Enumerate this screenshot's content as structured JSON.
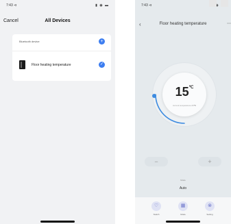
{
  "phone1": {
    "status": {
      "time": "7:43 ⊲",
      "icons": "▮ ◉ ▬"
    },
    "nav": {
      "cancel": "Cancel",
      "title": "All Devices"
    },
    "section_label": "Bluetooth device",
    "add_symbol": "+",
    "device": {
      "name": "Floor heating temperature",
      "check_symbol": "✓"
    }
  },
  "phone2": {
    "status": {
      "time": "7:43 ⊲",
      "icons": "▮ ◉ ▬"
    },
    "nav": {
      "back": "‹",
      "title": "Floor heating temperature",
      "more": "⋯"
    },
    "thermostat": {
      "temperature": "15",
      "unit": "℃",
      "subtitle": "current temperature 20℃"
    },
    "controls": {
      "minus": "−",
      "plus": "+"
    },
    "mode": {
      "label": "Mode",
      "value": "Auto"
    },
    "tabs": [
      {
        "label": "Switch",
        "icon": "♡"
      },
      {
        "label": "Mode",
        "icon": "▦"
      },
      {
        "label": "Setting",
        "icon": "⊗"
      }
    ],
    "accent": "#3d8be0"
  }
}
